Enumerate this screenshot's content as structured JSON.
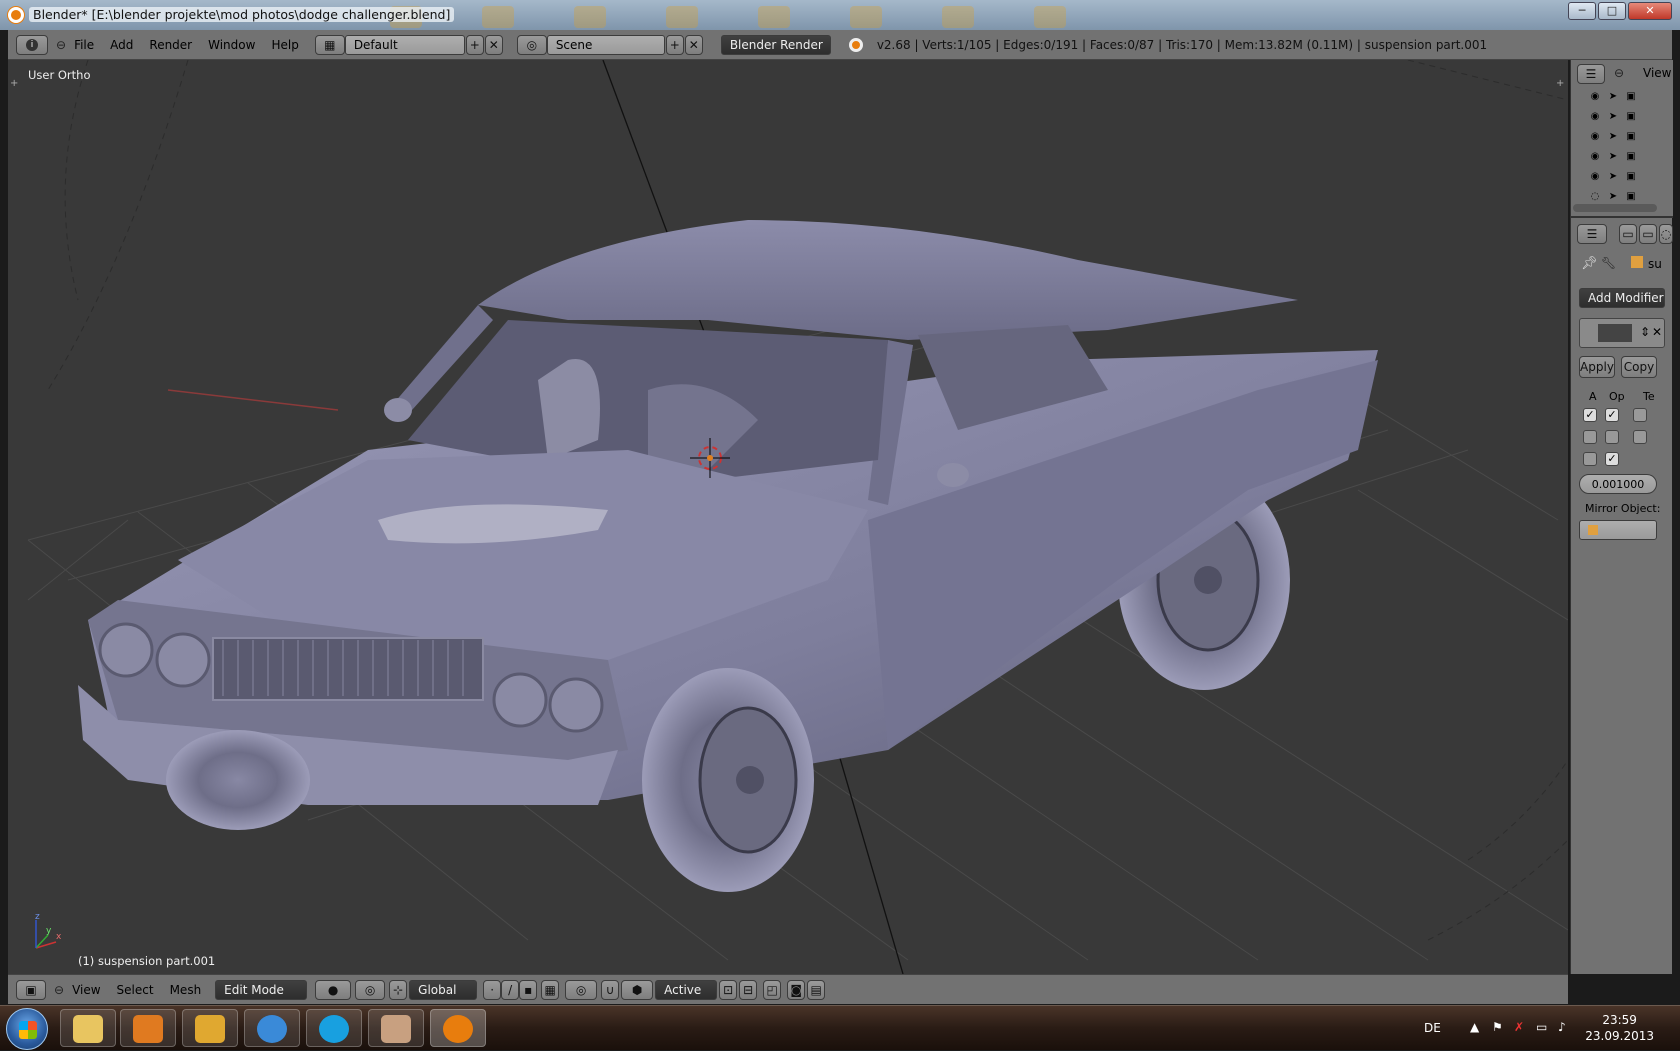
{
  "window": {
    "title": "Blender* [E:\\blender projekte\\mod photos\\dodge challenger.blend]",
    "minimize": "─",
    "maximize": "□",
    "close": "✕"
  },
  "infobar": {
    "menus": [
      "File",
      "Add",
      "Render",
      "Window",
      "Help"
    ],
    "layout": "Default",
    "scene": "Scene",
    "render_engine": "Blender Render",
    "stats": "v2.68 | Verts:1/105 | Edges:0/191 | Faces:0/87 | Tris:170 | Mem:13.82M (0.11M) | suspension part.001"
  },
  "viewport": {
    "view_label": "User Ortho",
    "object_label": "(1) suspension part.001",
    "axis_x": "x",
    "axis_y": "y",
    "axis_z": "z"
  },
  "properties": {
    "outliner_view": "View",
    "context_name": "su",
    "add_modifier": "Add Modifier",
    "apply": "Apply",
    "copy": "Copy",
    "col_a": "A",
    "col_op": "Op",
    "col_te": "Te",
    "merge_value": "0.001000",
    "mirror_object": "Mirror Object:"
  },
  "bottombar": {
    "menus": [
      "View",
      "Select",
      "Mesh"
    ],
    "mode": "Edit Mode",
    "orientation": "Global",
    "pivot_snap": "Active"
  },
  "taskbar": {
    "language": "DE",
    "time": "23:59",
    "date": "23.09.2013"
  }
}
